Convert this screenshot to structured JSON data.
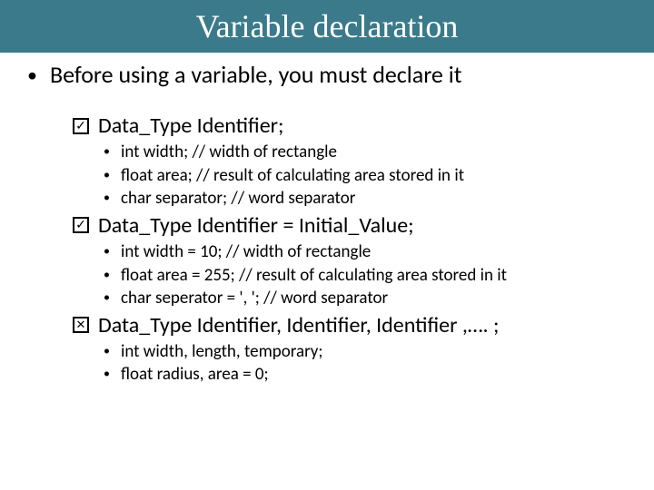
{
  "header": {
    "title": "Variable declaration"
  },
  "main_bullet": "Before using a variable, you must declare it",
  "sections": [
    {
      "mark": "check",
      "heading": "Data_Type Identifier;",
      "items": [
        "int width;  // width of rectangle",
        "float area; // result of calculating area stored in it",
        "char separator; // word separator"
      ]
    },
    {
      "mark": "check",
      "heading": "Data_Type Identifier = Initial_Value;",
      "items": [
        "int width = 10; // width of rectangle",
        "float area = 255; // result of calculating area stored in it",
        "char seperator = ', '; // word separator"
      ]
    },
    {
      "mark": "cross",
      "heading": "Data_Type Identifier, Identifier, Identifier ,…. ;",
      "items": [
        "int width, length, temporary;",
        "float radius, area = 0;"
      ]
    }
  ]
}
